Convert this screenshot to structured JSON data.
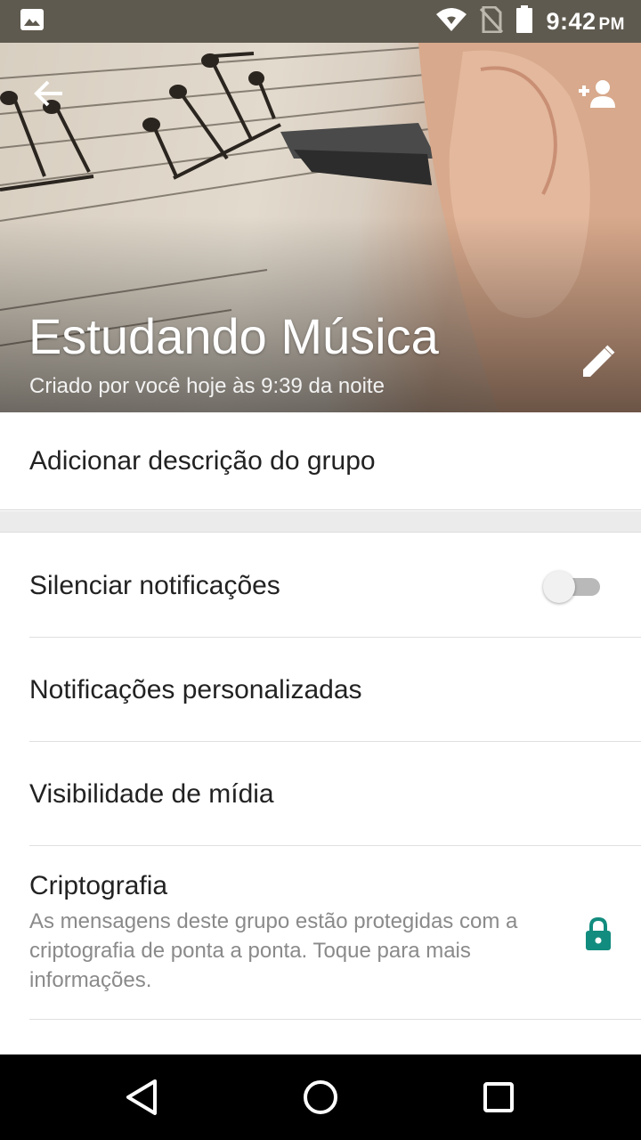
{
  "status_bar": {
    "time": "9:42",
    "ampm": "PM",
    "icons": [
      "image-icon",
      "wifi-icon",
      "no-sim-icon",
      "battery-icon"
    ]
  },
  "header": {
    "title": "Estudando Música",
    "subtitle": "Criado por você hoje às 9:39 da noite",
    "icons": [
      "back-arrow-icon",
      "add-person-icon",
      "pencil-icon"
    ]
  },
  "description": {
    "label": "Adicionar descrição do grupo"
  },
  "settings": {
    "mute": {
      "label": "Silenciar notificações",
      "enabled": false
    },
    "custom_notifications": {
      "label": "Notificações personalizadas"
    },
    "media_visibility": {
      "label": "Visibilidade de mídia"
    },
    "encryption": {
      "label": "Criptografia",
      "description": "As mensagens deste grupo estão protegidas com a criptografia de ponta a ponta. Toque para mais informações."
    }
  },
  "colors": {
    "status_bar": "#5f5a4f",
    "accent": "#128c7e",
    "primary_text": "#222222",
    "secondary_text": "#8a8a8a"
  },
  "nav_bar": {
    "icons": [
      "nav-back-icon",
      "nav-home-icon",
      "nav-recent-icon"
    ]
  }
}
